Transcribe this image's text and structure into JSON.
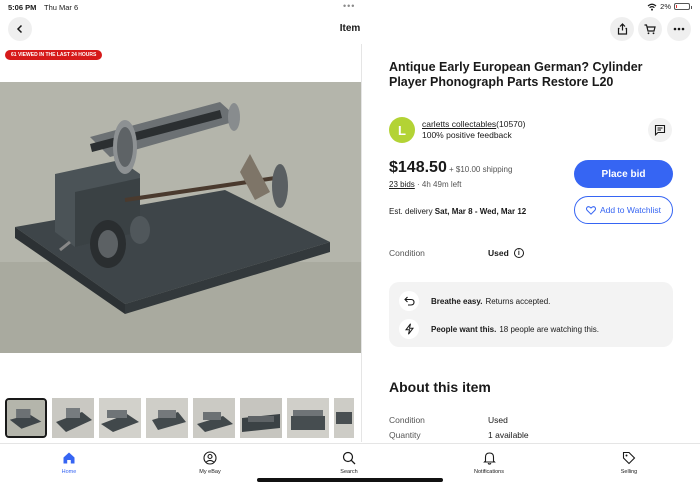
{
  "status_bar": {
    "time": "5:06 PM",
    "date": "Thu Mar 6",
    "battery": "2%"
  },
  "nav": {
    "title": "Item"
  },
  "media": {
    "viewed_badge": "61 VIEWED IN THE LAST 24 HOURS",
    "thumbnail_count": 8
  },
  "item": {
    "title": "Antique Early European German? Cylinder Player Phonograph Parts Restore L20",
    "seller": {
      "avatar_letter": "L",
      "name": "carletts collectables",
      "score": "(10570)",
      "feedback": "100% positive feedback"
    },
    "price": "$148.50",
    "shipping": "+ $10.00 shipping",
    "bids": "23 bids",
    "time_left": "· 4h 49m left",
    "delivery_label": "Est. delivery ",
    "delivery_dates": "Sat, Mar 8 - Wed, Mar 12",
    "condition_label": "Condition",
    "condition_value": "Used"
  },
  "actions": {
    "place_bid": "Place bid",
    "watchlist": "Add to Watchlist"
  },
  "benefits": [
    {
      "icon": "return-arrow-icon",
      "title": "Breathe easy.",
      "text": "Returns accepted."
    },
    {
      "icon": "lightning-icon",
      "title": "People want this.",
      "text": "18 people are watching this."
    }
  ],
  "about": {
    "heading": "About this item",
    "specs": [
      {
        "label": "Condition",
        "value": "Used"
      },
      {
        "label": "Quantity",
        "value": "1 available"
      }
    ]
  },
  "tabs": [
    {
      "label": "Home",
      "icon": "home-icon",
      "active": true
    },
    {
      "label": "My eBay",
      "icon": "person-icon",
      "active": false
    },
    {
      "label": "Search",
      "icon": "search-icon",
      "active": false
    },
    {
      "label": "Notifications",
      "icon": "bell-icon",
      "active": false
    },
    {
      "label": "Selling",
      "icon": "tag-icon",
      "active": false
    }
  ],
  "colors": {
    "accent": "#3665f3",
    "badge_red": "#d61a1a",
    "avatar_green": "#b3d335"
  }
}
